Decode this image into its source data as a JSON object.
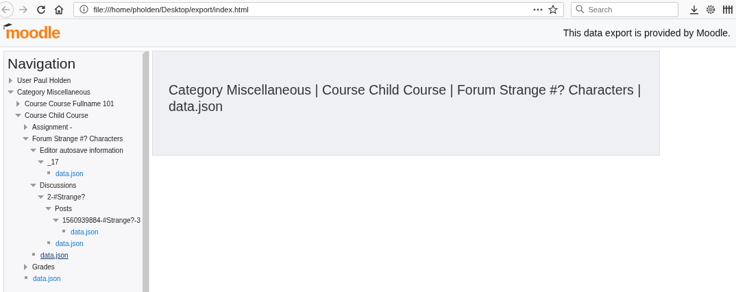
{
  "browser": {
    "url": "file:///home/pholden/Desktop/export/index.html",
    "search_placeholder": "Search"
  },
  "header": {
    "logo": "moodle",
    "notice": "This data export is provided by Moodle."
  },
  "navigation": {
    "title": "Navigation",
    "items": [
      {
        "kind": "branch",
        "label": "User Paul Holden",
        "expanded": false
      },
      {
        "kind": "branch",
        "label": "Category Miscellaneous",
        "expanded": true,
        "children": [
          {
            "kind": "branch",
            "label": "Course Course Fullname 101",
            "expanded": false
          },
          {
            "kind": "branch",
            "label": "Course Child Course",
            "expanded": true,
            "children": [
              {
                "kind": "branch",
                "label": "Assignment -",
                "expanded": false
              },
              {
                "kind": "branch",
                "label": "Forum Strange #? Characters",
                "expanded": true,
                "children": [
                  {
                    "kind": "branch",
                    "label": "Editor autosave information",
                    "expanded": true,
                    "children": [
                      {
                        "kind": "branch",
                        "label": "_17",
                        "expanded": true,
                        "children": [
                          {
                            "kind": "file",
                            "label": "data.json",
                            "hovered": false
                          }
                        ]
                      }
                    ]
                  },
                  {
                    "kind": "branch",
                    "label": "Discussions",
                    "expanded": true,
                    "children": [
                      {
                        "kind": "branch",
                        "label": "2-#Strange?",
                        "expanded": true,
                        "children": [
                          {
                            "kind": "branch",
                            "label": "Posts",
                            "expanded": true,
                            "children": [
                              {
                                "kind": "branch",
                                "label": "1560939884-#Strange?-3",
                                "expanded": true,
                                "children": [
                                  {
                                    "kind": "file",
                                    "label": "data.json",
                                    "hovered": false
                                  }
                                ]
                              }
                            ]
                          },
                          {
                            "kind": "file",
                            "label": "data.json",
                            "hovered": false
                          }
                        ]
                      }
                    ]
                  },
                  {
                    "kind": "file",
                    "label": "data.json",
                    "hovered": true
                  }
                ]
              },
              {
                "kind": "branch",
                "label": "Grades",
                "expanded": false
              },
              {
                "kind": "file",
                "label": "data.json",
                "hovered": false
              }
            ]
          }
        ]
      }
    ]
  },
  "content": {
    "breadcrumb": "Category Miscellaneous | Course Child Course | Forum Strange #? Characters | data.json"
  }
}
